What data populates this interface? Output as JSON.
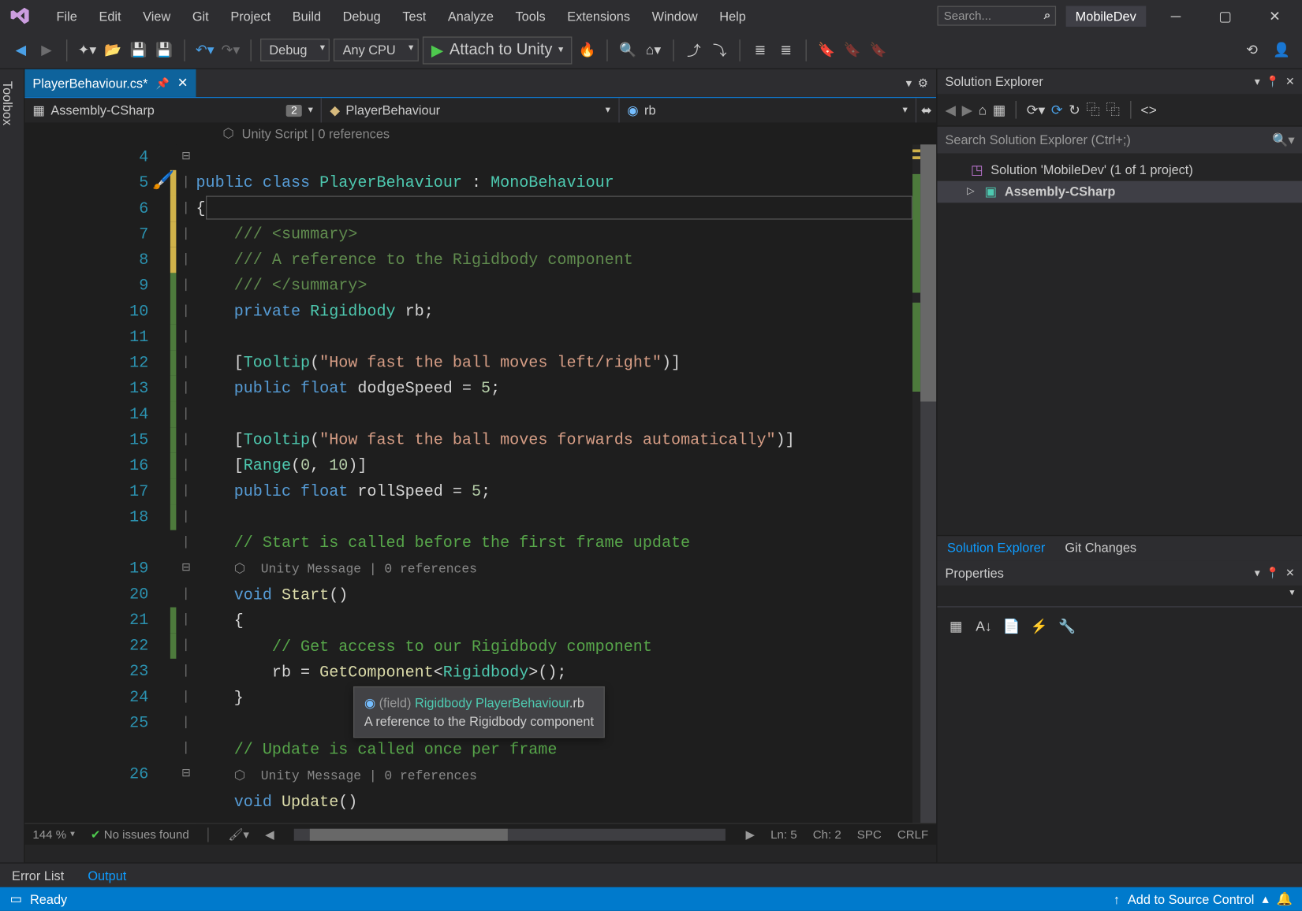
{
  "menubar": {
    "items": [
      "File",
      "Edit",
      "View",
      "Git",
      "Project",
      "Build",
      "Debug",
      "Test",
      "Analyze",
      "Tools",
      "Extensions",
      "Window",
      "Help"
    ],
    "search_placeholder": "Search...",
    "project_name": "MobileDev"
  },
  "toolbar": {
    "config": "Debug",
    "platform": "Any CPU",
    "start_label": "Attach to Unity"
  },
  "toolbox_rail": "Toolbox",
  "tabs": {
    "active_file": "PlayerBehaviour.cs*"
  },
  "nav": {
    "assembly": "Assembly-CSharp",
    "assembly_badge": "2",
    "class": "PlayerBehaviour",
    "member": "rb"
  },
  "codelens": {
    "top": "Unity Script | 0 references",
    "msg": "Unity Message | 0 references"
  },
  "code": {
    "line_numbers": [
      "4",
      "5",
      "6",
      "7",
      "8",
      "9",
      "10",
      "11",
      "12",
      "13",
      "14",
      "15",
      "16",
      "17",
      "18",
      "",
      "19",
      "20",
      "21",
      "22",
      "23",
      "24",
      "25",
      "",
      "26"
    ]
  },
  "tooltip": {
    "kind": "(field) ",
    "type": "Rigidbody PlayerBehaviour",
    "name": ".rb",
    "desc": "A reference to the Rigidbody component"
  },
  "editor_status": {
    "zoom": "144 %",
    "issues": "No issues found",
    "ln": "Ln: 5",
    "ch": "Ch: 2",
    "spc": "SPC",
    "crlf": "CRLF"
  },
  "solution_explorer": {
    "title": "Solution Explorer",
    "search_placeholder": "Search Solution Explorer (Ctrl+;)",
    "solution": "Solution 'MobileDev' (1 of 1 project)",
    "project": "Assembly-CSharp",
    "active_tab": "Solution Explorer",
    "other_tab": "Git Changes"
  },
  "properties": {
    "title": "Properties"
  },
  "bottom_tabs": {
    "error_list": "Error List",
    "output": "Output"
  },
  "statusbar": {
    "ready": "Ready",
    "source_control": "Add to Source Control"
  }
}
